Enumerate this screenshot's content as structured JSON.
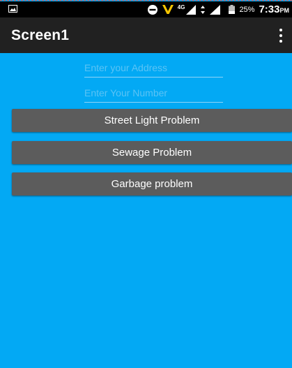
{
  "status_bar": {
    "network_label": "4G",
    "battery_percent": "25%",
    "time": "7:33",
    "time_suffix": "PM"
  },
  "app_bar": {
    "title": "Screen1",
    "menu_icon": "more-vert-icon"
  },
  "form": {
    "address_placeholder": "Enter your Address",
    "address_value": "",
    "number_placeholder": "Enter Your Number",
    "number_value": ""
  },
  "buttons": {
    "street_light": "Street Light Problem",
    "sewage": "Sewage Problem",
    "garbage": "Garbage problem"
  },
  "colors": {
    "background": "#03a9f4",
    "app_bar": "#212121",
    "button": "#5c5c5c",
    "status_bar": "#000000"
  }
}
